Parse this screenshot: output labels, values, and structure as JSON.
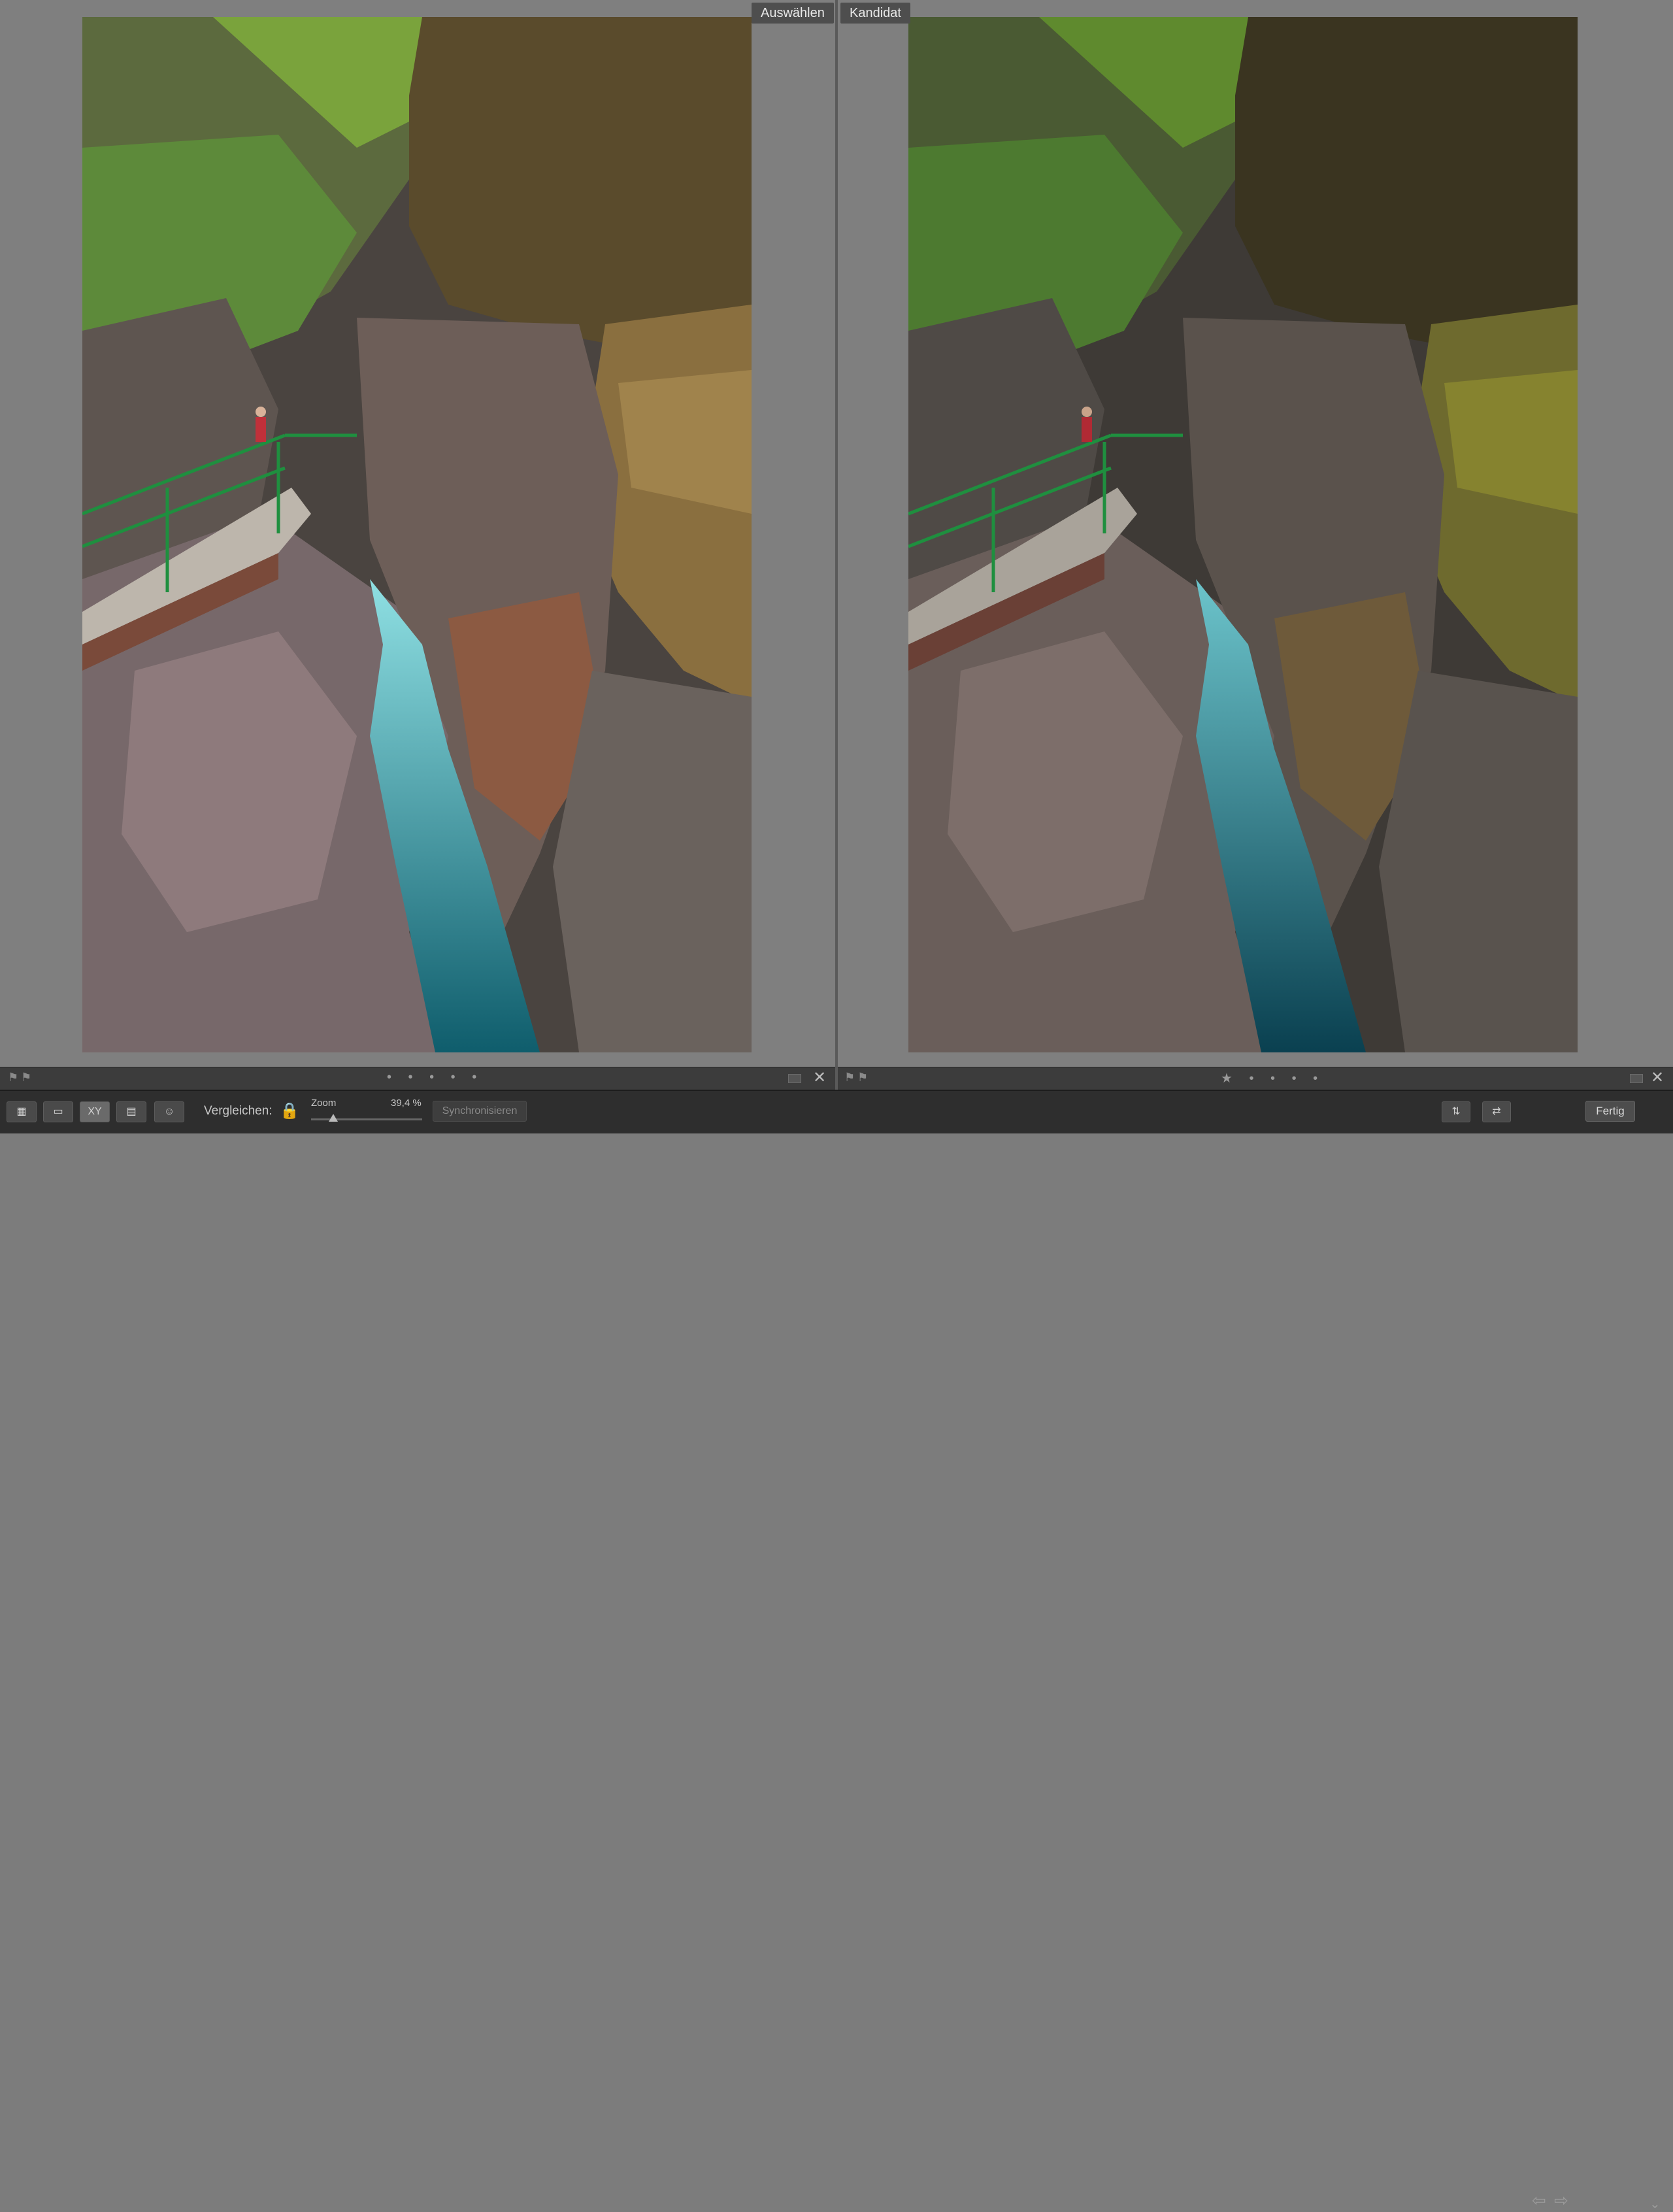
{
  "panes": {
    "left": {
      "tag": "Auswählen",
      "rating_dots": "• • • • •"
    },
    "right": {
      "tag": "Kandidat",
      "rating_dots": "★ • • • •"
    }
  },
  "close_glyph": "✕",
  "toolbar": {
    "compare_label": "Vergleichen:",
    "zoom_label": "Zoom",
    "zoom_value": "39,4 %",
    "zoom_fraction": 0.2,
    "sync_label": "Synchronisieren",
    "done_label": "Fertig",
    "view_buttons": [
      "grid-view",
      "loupe-view",
      "compare-view",
      "survey-view",
      "people-view"
    ],
    "compare_glyph": "XY"
  },
  "colors": {
    "background": "#7f7f7f",
    "toolbar": "#2e2e2e",
    "railing": "#1f8f3f",
    "water": "#1f8a92"
  }
}
